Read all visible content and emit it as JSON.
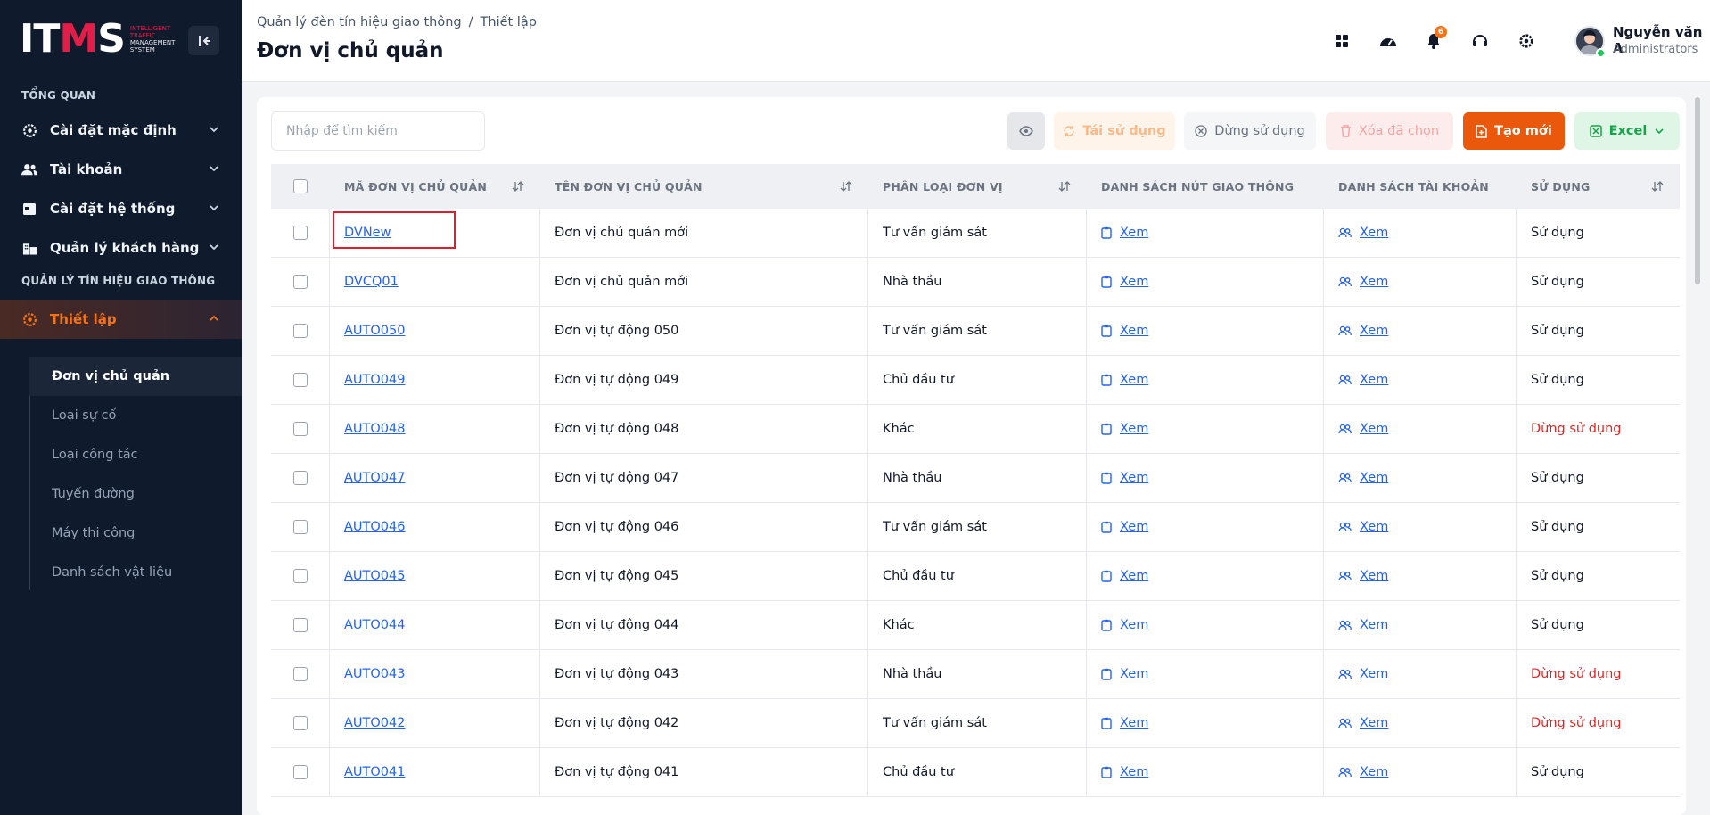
{
  "sidebar": {
    "logo": {
      "mark_prefix": "IT",
      "mark_m": "M",
      "mark_suffix": "S",
      "sub1": "INTELLIGENT",
      "sub2": "TRAFFIC",
      "sub3": "MANAGEMENT",
      "sub4": "SYSTEM"
    },
    "section1": "TỔNG QUAN",
    "items": [
      {
        "label": "Cài đặt mặc định",
        "icon": "gear-icon"
      },
      {
        "label": "Tài khoản",
        "icon": "users-icon"
      },
      {
        "label": "Cài đặt hệ thống",
        "icon": "calendar-icon"
      },
      {
        "label": "Quản lý khách hàng",
        "icon": "building-icon"
      }
    ],
    "section2": "QUẢN LÝ TÍN HIỆU GIAO THÔNG",
    "active_item": {
      "label": "Thiết lập",
      "icon": "gear-icon"
    },
    "subitems": [
      "Đơn vị chủ quản",
      "Loại sự cố",
      "Loại công tác",
      "Tuyến đường",
      "Máy thi công",
      "Danh sách vật liệu"
    ]
  },
  "header": {
    "breadcrumb": [
      "Quản lý đèn tín hiệu giao thông",
      "/",
      "Thiết lập"
    ],
    "title": "Đơn vị chủ quản",
    "notification_count": "6",
    "user_name": "Nguyễn văn A",
    "user_role": "Administrators"
  },
  "toolbar": {
    "search_placeholder": "Nhập để tìm kiếm",
    "reuse": "Tái sử dụng",
    "stop": "Dừng sử dụng",
    "delete": "Xóa đã chọn",
    "create": "Tạo mới",
    "excel": "Excel"
  },
  "table": {
    "columns": [
      "MÃ ĐƠN VỊ CHỦ QUẢN",
      "TÊN ĐƠN VỊ CHỦ QUẢN",
      "PHÂN LOẠI ĐƠN VỊ",
      "DANH SÁCH NÚT GIAO THÔNG",
      "DANH SÁCH TÀI KHOẢN",
      "SỬ DỤNG"
    ],
    "view_label": "Xem",
    "rows": [
      {
        "code": "DVNew",
        "name": "Đơn vị chủ quản mới",
        "type": "Tư vấn giám sát",
        "status": "Sử dụng",
        "active": true
      },
      {
        "code": "DVCQ01",
        "name": "Đơn vị chủ quản mới",
        "type": "Nhà thầu",
        "status": "Sử dụng",
        "active": true
      },
      {
        "code": "AUTO050",
        "name": "Đơn vị tự động 050",
        "type": "Tư vấn giám sát",
        "status": "Sử dụng",
        "active": true
      },
      {
        "code": "AUTO049",
        "name": "Đơn vị tự động 049",
        "type": "Chủ đầu tư",
        "status": "Sử dụng",
        "active": true
      },
      {
        "code": "AUTO048",
        "name": "Đơn vị tự động 048",
        "type": "Khác",
        "status": "Dừng sử dụng",
        "active": false
      },
      {
        "code": "AUTO047",
        "name": "Đơn vị tự động 047",
        "type": "Nhà thầu",
        "status": "Sử dụng",
        "active": true
      },
      {
        "code": "AUTO046",
        "name": "Đơn vị tự động 046",
        "type": "Tư vấn giám sát",
        "status": "Sử dụng",
        "active": true
      },
      {
        "code": "AUTO045",
        "name": "Đơn vị tự động 045",
        "type": "Chủ đầu tư",
        "status": "Sử dụng",
        "active": true
      },
      {
        "code": "AUTO044",
        "name": "Đơn vị tự động 044",
        "type": "Khác",
        "status": "Sử dụng",
        "active": true
      },
      {
        "code": "AUTO043",
        "name": "Đơn vị tự động 043",
        "type": "Nhà thầu",
        "status": "Dừng sử dụng",
        "active": false
      },
      {
        "code": "AUTO042",
        "name": "Đơn vị tự động 042",
        "type": "Tư vấn giám sát",
        "status": "Dừng sử dụng",
        "active": false
      },
      {
        "code": "AUTO041",
        "name": "Đơn vị tự động 041",
        "type": "Chủ đầu tư",
        "status": "Sử dụng",
        "active": true
      }
    ]
  },
  "colors": {
    "accent": "#ea580c",
    "sidebar_bg": "#0f1b2d",
    "link": "#2563eb",
    "inactive": "#dc2626"
  }
}
